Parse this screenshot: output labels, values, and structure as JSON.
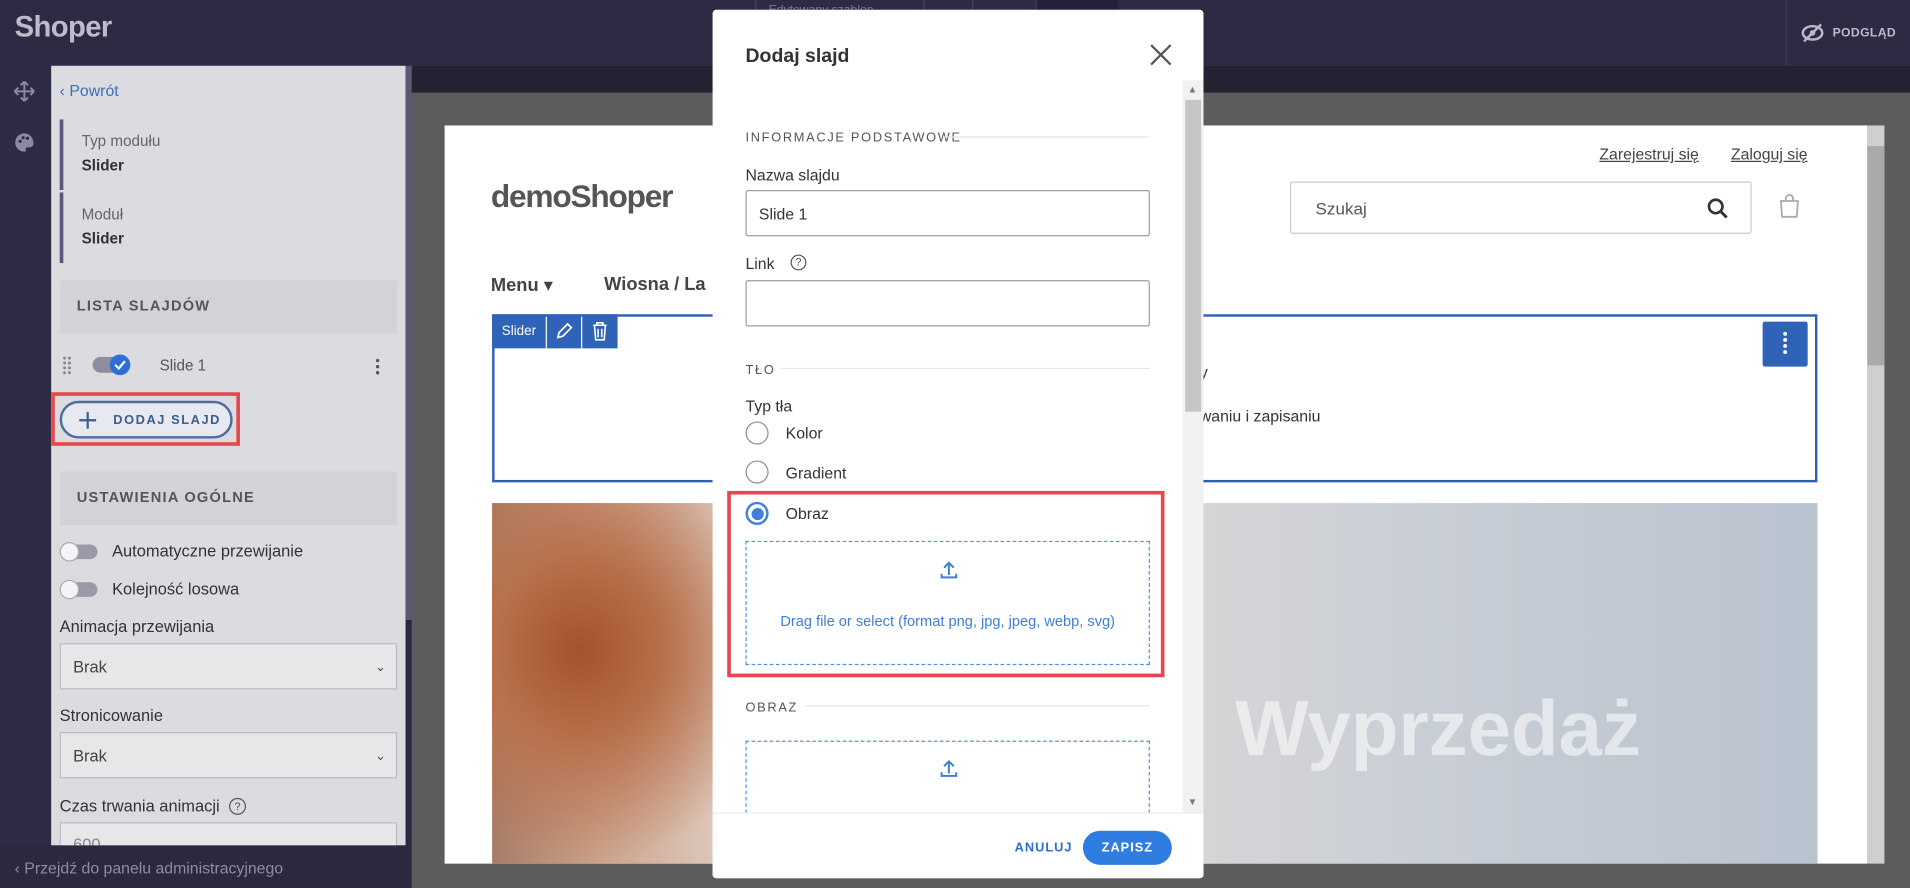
{
  "app": {
    "logo": "Shoper",
    "tab_stub": "Edytowany szablon",
    "preview_label": "PODGLĄD"
  },
  "sidebar": {
    "back_label": "Powrót",
    "module_type_label": "Typ modułu",
    "module_type_value": "Slider",
    "module_label": "Moduł",
    "module_value": "Slider",
    "slides_header": "LISTA SLAJDÓW",
    "slides": [
      {
        "name": "Slide 1",
        "enabled": true
      }
    ],
    "add_slide_label": "DODAJ SLAJD",
    "general_header": "USTAWIENIA OGÓLNE",
    "auto_scroll_label": "Automatyczne przewijanie",
    "random_order_label": "Kolejność losowa",
    "animation_label": "Animacja przewijania",
    "animation_value": "Brak",
    "paging_label": "Stronicowanie",
    "paging_value": "Brak",
    "duration_label": "Czas trwania animacji",
    "duration_value": "600"
  },
  "bottom_bar": {
    "admin_link": "Przejdź do panelu administracyjnego"
  },
  "store": {
    "logo": "demoShoper",
    "register": "Zarejestruj się",
    "login": "Zaloguj się",
    "search_placeholder": "Szukaj",
    "menu_label": "Menu",
    "nav_item": "Wiosna / La",
    "slider_tag": "Slider",
    "slider_hint_1": "y",
    "slider_hint_2": "waniu i zapisaniu",
    "banner_text": "Wyprzedaż"
  },
  "modal": {
    "title": "Dodaj slajd",
    "section_basic": "INFORMACJE PODSTAWOWE",
    "name_label": "Nazwa slajdu",
    "name_value": "Slide 1",
    "link_label": "Link",
    "link_value": "",
    "section_bg": "TŁO",
    "bg_type_label": "Typ tła",
    "bg_options": [
      {
        "label": "Kolor",
        "selected": false
      },
      {
        "label": "Gradient",
        "selected": false
      },
      {
        "label": "Obraz",
        "selected": true
      }
    ],
    "drop_text": "Drag file or select (format png, jpg, jpeg, webp, svg)",
    "section_image": "OBRAZ",
    "cancel_label": "ANULUJ",
    "save_label": "ZAPISZ"
  },
  "colors": {
    "accent": "#2f7de1",
    "highlight": "#e5484d",
    "topbar": "#2d2a44"
  }
}
